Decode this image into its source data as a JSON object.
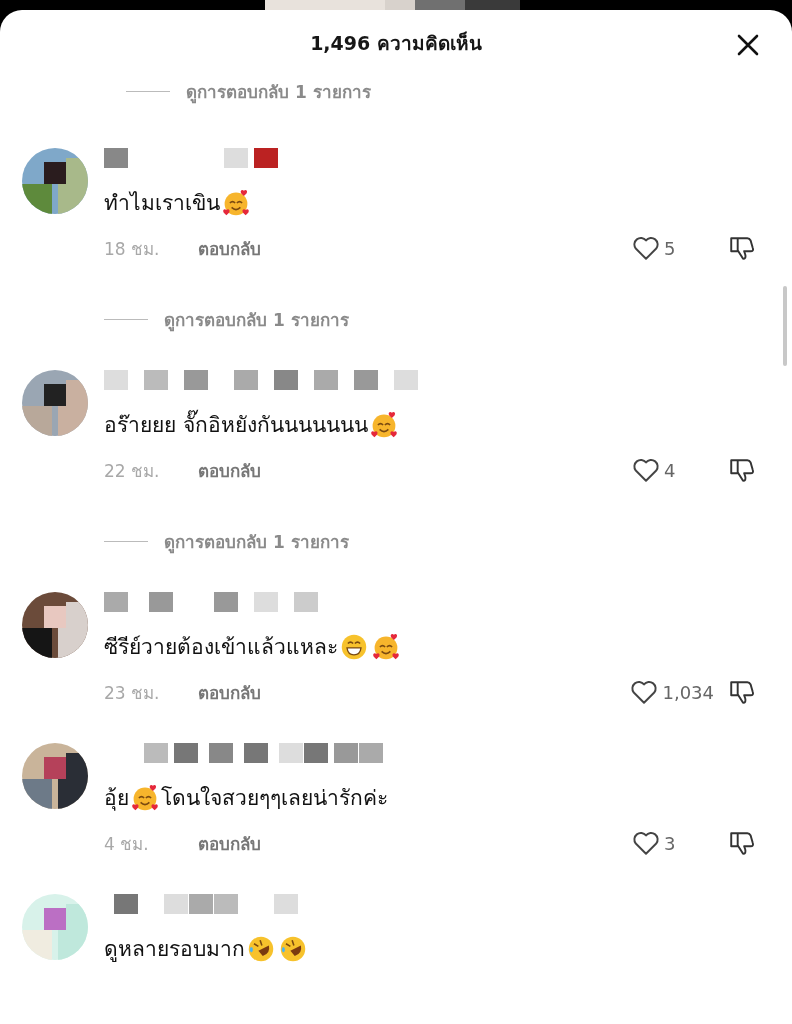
{
  "header": {
    "title": "1,496 ความคิดเห็น"
  },
  "top_replies_link": "ดูการตอบกลับ 1 รายการ",
  "comments": [
    {
      "segments": [
        {
          "kind": "text",
          "text": "ทำไมเราเขิน"
        },
        {
          "kind": "hearts"
        }
      ],
      "time": "18 ชม.",
      "reply": "ตอบกลับ",
      "likes": "5",
      "replies_link": "ดูการตอบกลับ 1 รายการ"
    },
    {
      "segments": [
        {
          "kind": "text",
          "text": "อร๊ายยย จั๊กอิหยังกันนนนนนน"
        },
        {
          "kind": "hearts"
        }
      ],
      "time": "22 ชม.",
      "reply": "ตอบกลับ",
      "likes": "4",
      "replies_link": "ดูการตอบกลับ 1 รายการ"
    },
    {
      "segments": [
        {
          "kind": "text",
          "text": "ซีรีย์วายต้องเข้าแล้วแหละ"
        },
        {
          "kind": "grin"
        },
        {
          "kind": "hearts"
        }
      ],
      "time": "23 ชม.",
      "reply": "ตอบกลับ",
      "likes": "1,034"
    },
    {
      "segments": [
        {
          "kind": "text",
          "text": "อุ้ย"
        },
        {
          "kind": "hearts"
        },
        {
          "kind": "text",
          "text": "โดนใจสวยๆๆเลยน่ารักค่ะ"
        }
      ],
      "time": "4 ชม.",
      "reply": "ตอบกลับ",
      "likes": "3"
    },
    {
      "segments": [
        {
          "kind": "text",
          "text": "ดูหลายรอบมาก"
        },
        {
          "kind": "rofl"
        },
        {
          "kind": "rofl"
        }
      ]
    }
  ]
}
